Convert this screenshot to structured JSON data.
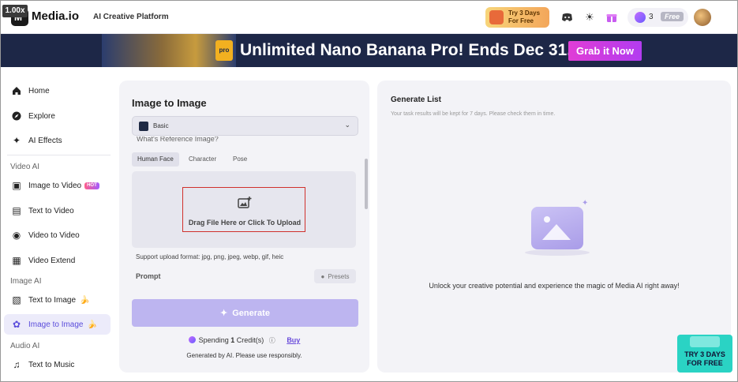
{
  "overlay": {
    "zoom": "1.00x"
  },
  "header": {
    "brand": "Media.io",
    "platform": "AI Creative Platform",
    "trial_line1": "Try 3 Days",
    "trial_line2": "For Free",
    "credits": "3",
    "plan": "Free",
    "icons": [
      "discord-icon",
      "sun-icon",
      "gift-icon"
    ]
  },
  "banner": {
    "art_label": "pro",
    "headline": "Unlimited Nano Banana Pro! Ends Dec 31.",
    "cta": "Grab it Now"
  },
  "sidebar": {
    "items_top": [
      {
        "label": "Home",
        "icon": "home-icon"
      },
      {
        "label": "Explore",
        "icon": "compass-icon"
      },
      {
        "label": "AI Effects",
        "icon": "sparkle-icon"
      }
    ],
    "section_video": "Video AI",
    "video_items": [
      {
        "label": "Image to Video",
        "badge": "HOT",
        "icon": "image-video-icon"
      },
      {
        "label": "Text to Video",
        "icon": "text-video-icon"
      },
      {
        "label": "Video to Video",
        "icon": "video-video-icon"
      },
      {
        "label": "Video Extend",
        "icon": "video-extend-icon"
      }
    ],
    "section_image": "Image AI",
    "image_items": [
      {
        "label": "Text to Image",
        "icon": "text-image-icon"
      },
      {
        "label": "Image to Image",
        "icon": "image-image-icon",
        "active": true
      }
    ],
    "section_audio": "Audio AI",
    "audio_items": [
      {
        "label": "Text to Music",
        "icon": "music-icon"
      }
    ]
  },
  "editor": {
    "title": "Image to Image",
    "model": "Basic",
    "cut_label": "What's Reference Image?",
    "ref_tabs": [
      "Human Face",
      "Character",
      "Pose"
    ],
    "upload_text": "Drag File Here or Click To Upload",
    "support_text": "Support upload format: jpg, png, jpeg, webp, gif, heic",
    "prompt_label": "Prompt",
    "presets": "Presets",
    "generate": "Generate",
    "spend_prefix": "Spending",
    "spend_amount": "1",
    "spend_suffix": "Credit(s)",
    "buy": "Buy",
    "disclaimer": "Generated by AI. Please use responsibly."
  },
  "results": {
    "title": "Generate List",
    "subtitle": "Your task results will be kept for 7 days. Please check them in time.",
    "empty_message": "Unlock your creative potential and experience the magic of Media AI right away!"
  },
  "floating": {
    "try_line1": "TRY 3 DAYS",
    "try_line2": "FOR FREE"
  },
  "colors": {
    "accent": "#5a4cdb",
    "banner_bg": "#1d2747",
    "cta": "#d43ce0",
    "generate_disabled": "#bdb5f0"
  }
}
